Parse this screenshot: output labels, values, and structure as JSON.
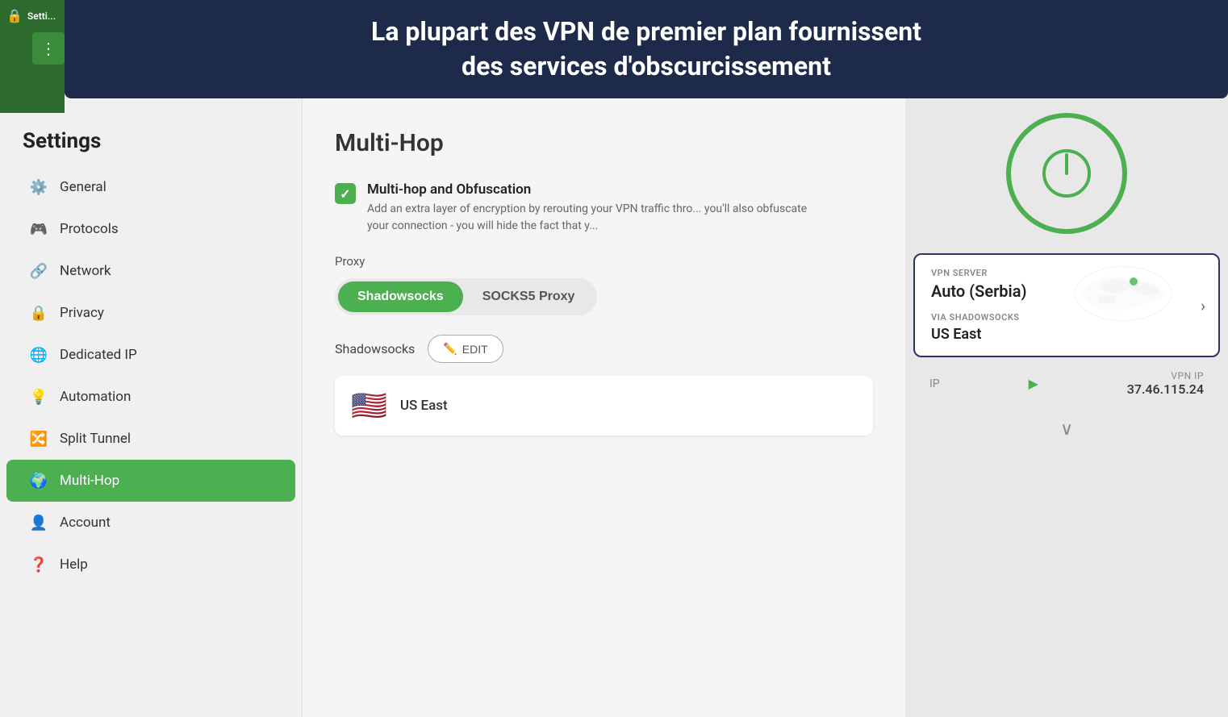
{
  "app": {
    "name": "Settings",
    "icon": "🔒"
  },
  "banner": {
    "line1": "La plupart des VPN de premier plan fournissent",
    "line2": "des services d'obscurcissement"
  },
  "sidebar": {
    "title": "Settings",
    "items": [
      {
        "id": "general",
        "label": "General",
        "icon": "⚙️",
        "active": false
      },
      {
        "id": "protocols",
        "label": "Protocols",
        "icon": "🎮",
        "active": false
      },
      {
        "id": "network",
        "label": "Network",
        "icon": "🔗",
        "active": false
      },
      {
        "id": "privacy",
        "label": "Privacy",
        "icon": "🔒",
        "active": false
      },
      {
        "id": "dedicated-ip",
        "label": "Dedicated IP",
        "icon": "🌐",
        "active": false
      },
      {
        "id": "automation",
        "label": "Automation",
        "icon": "💡",
        "active": false
      },
      {
        "id": "split-tunnel",
        "label": "Split Tunnel",
        "icon": "🔀",
        "active": false
      },
      {
        "id": "multi-hop",
        "label": "Multi-Hop",
        "icon": "🌍",
        "active": true
      },
      {
        "id": "account",
        "label": "Account",
        "icon": "👤",
        "active": false
      },
      {
        "id": "help",
        "label": "Help",
        "icon": "❓",
        "active": false
      }
    ]
  },
  "main": {
    "page_title": "Multi-Hop",
    "checkbox": {
      "label": "Multi-hop and Obfuscation",
      "checked": true,
      "description": "Add an extra layer of encryption by rerouting your VPN traffic thro... you'll also obfuscate your connection - you will hide the fact that y..."
    },
    "proxy_section": {
      "label": "Proxy",
      "buttons": [
        {
          "id": "shadowsocks",
          "label": "Shadowsocks",
          "active": true
        },
        {
          "id": "socks5",
          "label": "SOCKS5 Proxy",
          "active": false
        }
      ]
    },
    "shadowsocks_row": {
      "label": "Shadowsocks",
      "edit_label": "EDIT"
    },
    "server_item": {
      "flag": "🇺🇸",
      "name": "US East"
    }
  },
  "right_panel": {
    "vpn_server": {
      "label": "VPN SERVER",
      "value": "Auto (Serbia)"
    },
    "via": {
      "label": "VIA SHADOWSOCKS",
      "value": "US East"
    },
    "ip": {
      "label": "IP",
      "vpn_ip_label": "VPN IP",
      "vpn_ip_value": "37.46.115.24"
    }
  },
  "three_dots": "⋮"
}
